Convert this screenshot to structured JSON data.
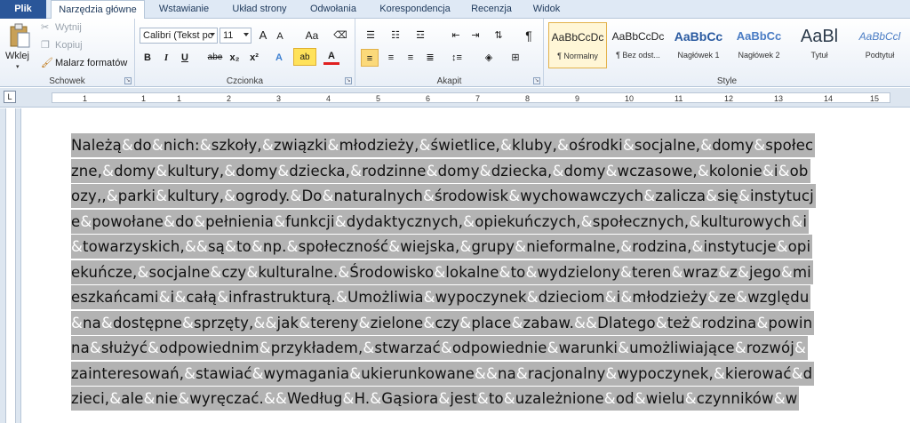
{
  "tabs": [
    {
      "label": "Plik",
      "kind": "file"
    },
    {
      "label": "Narzędzia główne",
      "kind": "active"
    },
    {
      "label": "Wstawianie",
      "kind": "tab"
    },
    {
      "label": "Układ strony",
      "kind": "tab"
    },
    {
      "label": "Odwołania",
      "kind": "tab"
    },
    {
      "label": "Korespondencja",
      "kind": "tab"
    },
    {
      "label": "Recenzja",
      "kind": "tab"
    },
    {
      "label": "Widok",
      "kind": "tab"
    }
  ],
  "clipboard": {
    "paste": "Wklej",
    "cut": "Wytnij",
    "copy": "Kopiuj",
    "format_painter": "Malarz formatów",
    "label": "Schowek"
  },
  "font": {
    "font_name": "Calibri (Tekst pc",
    "font_size": "11",
    "grow": "A",
    "shrink": "A",
    "change_case": "Aa",
    "bold": "B",
    "italic": "I",
    "underline": "U",
    "strike": "abe",
    "subscript": "x₂",
    "superscript": "x²",
    "label": "Czcionka"
  },
  "paragraph": {
    "pilcrow": "¶",
    "label": "Akapit"
  },
  "styles": {
    "label": "Style",
    "items": [
      {
        "sample": "AaBbCcDc",
        "name": "¶ Normalny"
      },
      {
        "sample": "AaBbCcDc",
        "name": "¶ Bez odst..."
      },
      {
        "sample": "AaBbCc",
        "name": "Nagłówek 1"
      },
      {
        "sample": "AaBbCc",
        "name": "Nagłówek 2"
      },
      {
        "sample": "AaBl",
        "name": "Tytuł"
      },
      {
        "sample": "AaBbCcl",
        "name": "Podtytuł"
      }
    ]
  },
  "ruler_numbers": [
    "1",
    "2",
    "1",
    "1",
    "2",
    "3",
    "4",
    "5",
    "6",
    "7",
    "8",
    "9",
    "10",
    "11",
    "12",
    "13",
    "14",
    "15"
  ],
  "document_lines": [
    "Należą&do&nich:&szkoły,&związki&młodzieży,&świetlice,&kluby,&ośrodki&socjalne,&domy&społec",
    "zne,&domy&kultury,&domy&dziecka,&rodzinne&domy&dziecka,&domy&wczasowe,&kolonie&i&ob",
    "ozy,,&parki&kultury,&ogrody.&Do&naturalnych&środowisk&wychowawczych&zalicza&się&instytucj",
    "e&powołane&do&pełnienia&funkcji&dydaktycznych,&opiekuńczych,&społecznych,&kulturowych&i",
    "&towarzyskich,&&są&to&np.&społeczność&wiejska,&grupy&nieformalne,&rodzina,&instytucje&opi",
    "ekuńcze,&socjalne&czy&kulturalne.&Środowisko&lokalne&to&wydzielony&teren&wraz&z&jego&mi",
    "eszkańcami&i&całą&infrastrukturą.&Umożliwia&wypoczynek&dzieciom&i&młodzieży&ze&względu",
    "&na&dostępne&sprzęty,&&jak&tereny&zielone&czy&place&zabaw.&&Dlatego&też&rodzina&powin",
    "na&służyć&odpowiednim&przykładem,&stwarzać&odpowiednie&warunki&umożliwiające&rozwój&",
    "zainteresowań,&stawiać&wymagania&ukierunkowane&&na&racjonalny&wypoczynek,&kierować&d",
    "zieci,&ale&nie&wyręczać.&&Według&H.&Gąsiora&jest&to&uzależnione&od&wielu&czynników&w"
  ]
}
